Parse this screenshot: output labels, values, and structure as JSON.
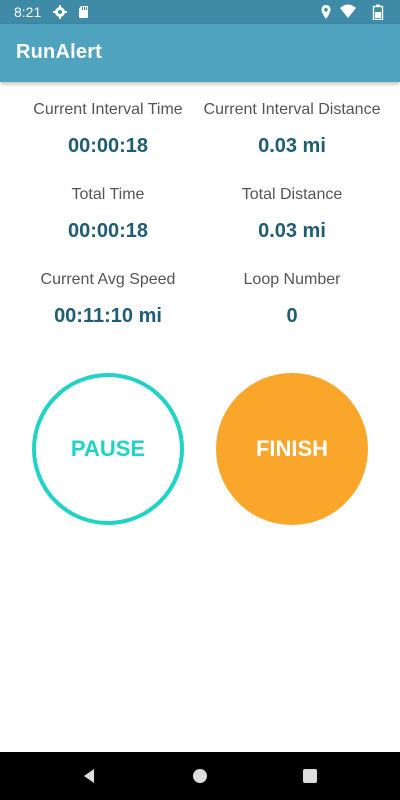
{
  "status_bar": {
    "time": "8:21",
    "icons": [
      "settings-icon",
      "sd-card-icon",
      "location-icon",
      "wifi-icon",
      "battery-icon"
    ]
  },
  "app_bar": {
    "title": "RunAlert"
  },
  "stats": {
    "current_interval_time": {
      "label": "Current Interval Time",
      "value": "00:00:18"
    },
    "current_interval_distance": {
      "label": "Current Interval Distance",
      "value": "0.03 mi"
    },
    "total_time": {
      "label": "Total Time",
      "value": "00:00:18"
    },
    "total_distance": {
      "label": "Total Distance",
      "value": "0.03 mi"
    },
    "current_avg_speed": {
      "label": "Current Avg Speed",
      "value": "00:11:10 mi"
    },
    "loop_number": {
      "label": "Loop Number",
      "value": "0"
    }
  },
  "buttons": {
    "pause_label": "PAUSE",
    "finish_label": "FINISH"
  },
  "colors": {
    "status_bar": "#3f8aa6",
    "app_bar": "#4fa3bf",
    "value_text": "#1f5d74",
    "pause_accent": "#1fd3c6",
    "finish_fill": "#faa62b",
    "nav_bar": "#000000"
  },
  "nav_bar": {
    "icons": [
      "back-icon",
      "home-icon",
      "recents-icon"
    ]
  }
}
